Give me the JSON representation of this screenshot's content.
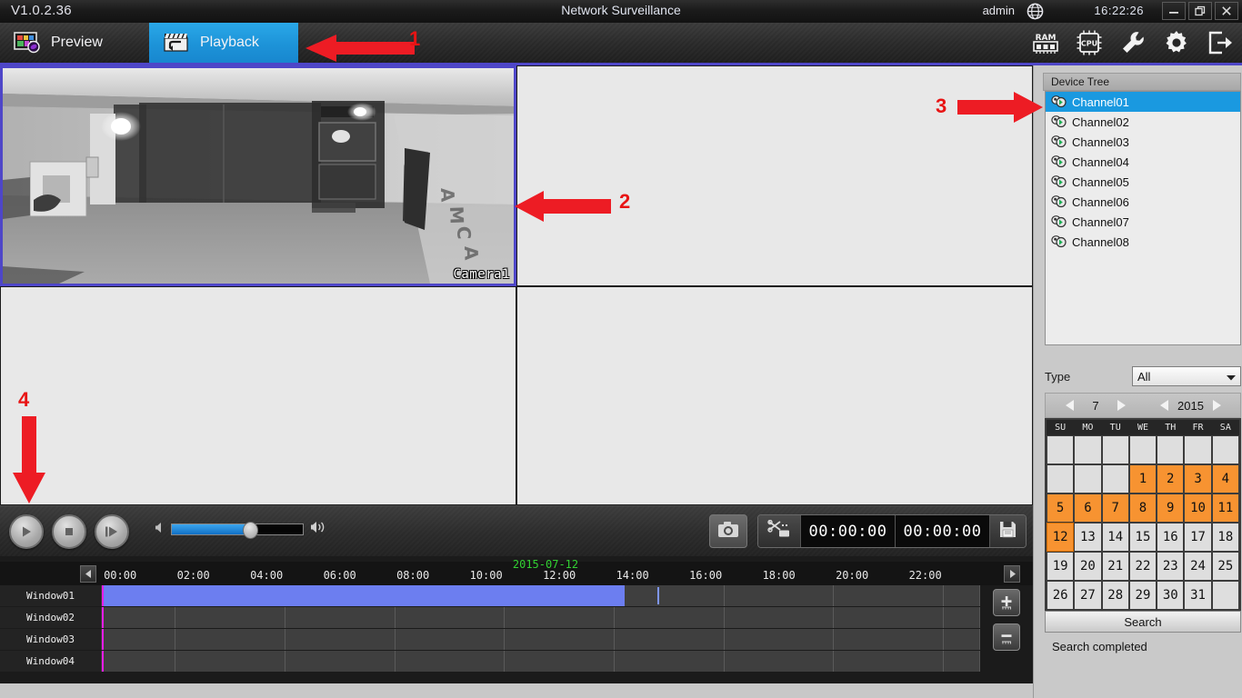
{
  "titlebar": {
    "version": "V1.0.2.36",
    "app_title": "Network Surveillance",
    "user": "admin",
    "globe_icon": "globe-icon",
    "clock": "16:22:26",
    "minimize_icon": "minimize-icon",
    "restore_icon": "restore-icon",
    "close_icon": "close-icon"
  },
  "toolbar": {
    "tabs": [
      {
        "label": "Preview",
        "icon": "preview-monitor-icon",
        "active": false
      },
      {
        "label": "Playback",
        "icon": "clapperboard-playback-icon",
        "active": true
      }
    ],
    "tools": [
      {
        "name": "ram-icon",
        "label": "RAM"
      },
      {
        "name": "cpu-icon",
        "label": "CPU"
      },
      {
        "name": "wrench-icon",
        "label": ""
      },
      {
        "name": "gear-icon",
        "label": ""
      },
      {
        "name": "logout-icon",
        "label": ""
      }
    ]
  },
  "video_grid": {
    "panes": [
      {
        "id": "pane-1",
        "active": true,
        "camera_label": "Camera1",
        "has_video": true
      },
      {
        "id": "pane-2",
        "active": false,
        "camera_label": "",
        "has_video": false
      },
      {
        "id": "pane-3",
        "active": false,
        "camera_label": "",
        "has_video": false
      },
      {
        "id": "pane-4",
        "active": false,
        "camera_label": "",
        "has_video": false
      }
    ],
    "selected_border_color": "#4e46c8",
    "empty_pane_color": "#e8e8e8"
  },
  "controls": {
    "play_icon": "play-icon",
    "stop_icon": "stop-icon",
    "frame_step_icon": "frame-step-icon",
    "volume_mute_icon": "volume-low-icon",
    "volume_up_icon": "volume-high-icon",
    "volume_percent": 60,
    "snapshot_icon": "camera-snapshot-icon",
    "clip_icon": "scissors-clip-icon",
    "clip_start_time": "00:00:00",
    "clip_end_time": "00:00:00",
    "save_icon": "floppy-save-icon"
  },
  "timeline": {
    "date_label": "2015-07-12",
    "scroll_left_icon": "scroll-left-icon",
    "scroll_right_icon": "scroll-right-icon",
    "zoom_in_icon": "zoom-in-icon",
    "zoom_out_icon": "zoom-out-icon",
    "ticks": [
      "00:00",
      "02:00",
      "04:00",
      "06:00",
      "08:00",
      "10:00",
      "12:00",
      "14:00",
      "16:00",
      "18:00",
      "20:00",
      "22:00"
    ],
    "rows": [
      {
        "label": "Window01",
        "has_recording": true,
        "rec_start_hour": 0,
        "rec_end_hour": 14.3
      },
      {
        "label": "Window02",
        "has_recording": false
      },
      {
        "label": "Window03",
        "has_recording": false
      },
      {
        "label": "Window04",
        "has_recording": false
      }
    ],
    "playhead_hour": 0,
    "cursor_hour": 15.2,
    "recording_color": "#6c7ef0",
    "playhead_color": "#ea1ce8"
  },
  "right_panel": {
    "device_tree": {
      "header": "Device Tree",
      "channels": [
        {
          "label": "Channel01",
          "selected": true
        },
        {
          "label": "Channel02",
          "selected": false
        },
        {
          "label": "Channel03",
          "selected": false
        },
        {
          "label": "Channel04",
          "selected": false
        },
        {
          "label": "Channel05",
          "selected": false
        },
        {
          "label": "Channel06",
          "selected": false
        },
        {
          "label": "Channel07",
          "selected": false
        },
        {
          "label": "Channel08",
          "selected": false
        }
      ],
      "channel_icon": "camera-channel-icon"
    },
    "type_filter": {
      "label": "Type",
      "value": "All",
      "dropdown_icon": "chevron-down-icon"
    },
    "calendar": {
      "month": "7",
      "year": "2015",
      "prev_month_icon": "prev-arrow-icon",
      "next_month_icon": "next-arrow-icon",
      "prev_year_icon": "prev-arrow-icon",
      "next_year_icon": "next-arrow-icon",
      "weekdays": [
        "SU",
        "MO",
        "TU",
        "WE",
        "TH",
        "FR",
        "SA"
      ],
      "weeks": [
        [
          "",
          "",
          "",
          "",
          "",
          "",
          ""
        ],
        [
          "",
          "",
          "",
          "1",
          "2",
          "3",
          "4"
        ],
        [
          "5",
          "6",
          "7",
          "8",
          "9",
          "10",
          "11"
        ],
        [
          "12",
          "13",
          "14",
          "15",
          "16",
          "17",
          "18"
        ],
        [
          "19",
          "20",
          "21",
          "22",
          "23",
          "24",
          "25"
        ],
        [
          "26",
          "27",
          "28",
          "29",
          "30",
          "31",
          ""
        ]
      ],
      "recorded_days": [
        "1",
        "2",
        "3",
        "4",
        "5",
        "6",
        "7",
        "8",
        "9",
        "10",
        "11",
        "12"
      ],
      "selected_day": "12",
      "recorded_color": "#f79331"
    },
    "search_button": "Search",
    "search_status": "Search completed",
    "collapse_icon": "collapse-panel-icon"
  },
  "annotations": [
    {
      "number": "1",
      "direction": "left",
      "target": "playback-tab"
    },
    {
      "number": "2",
      "direction": "left",
      "target": "video-pane-1"
    },
    {
      "number": "3",
      "direction": "right",
      "target": "channel01-item"
    },
    {
      "number": "4",
      "direction": "down",
      "target": "playback-controls"
    }
  ]
}
